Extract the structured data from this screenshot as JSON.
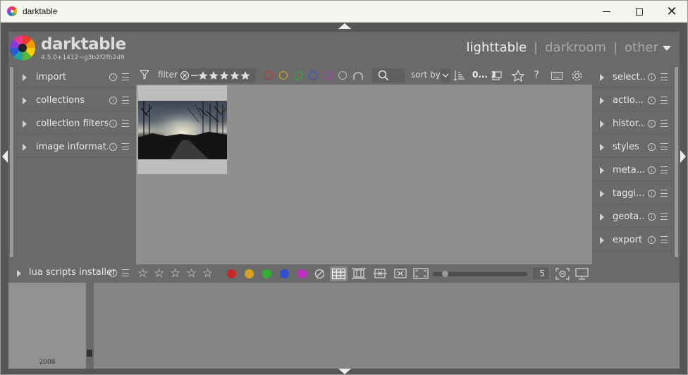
{
  "window": {
    "title": "darktable",
    "controls": {
      "minimize": "minimize",
      "maximize": "maximize",
      "close": "close"
    }
  },
  "header": {
    "brand": "darktable",
    "version": "4.5.0+1412~g3b2f2fb2d9",
    "views": [
      "lighttable",
      "darkroom",
      "other"
    ],
    "active_view": "lighttable",
    "separator": "|"
  },
  "left_panel": {
    "modules": [
      {
        "label": "import"
      },
      {
        "label": "collections"
      },
      {
        "label": "collection filters"
      },
      {
        "label": "image informat..."
      }
    ],
    "lua": {
      "label": "lua scripts installer"
    }
  },
  "toolbar": {
    "filter_label": "filter",
    "sort_label": "sort by",
    "count": "0... 1",
    "color_labels": [
      {
        "name": "red",
        "color": "#d02c2c"
      },
      {
        "name": "yellow",
        "color": "#d9a81c"
      },
      {
        "name": "green",
        "color": "#2fb12f"
      },
      {
        "name": "blue",
        "color": "#2f4fd9"
      },
      {
        "name": "purple",
        "color": "#c02fc0"
      },
      {
        "name": "gray",
        "color": "#bdbdbd"
      }
    ]
  },
  "right_panel": {
    "modules": [
      {
        "label": "select..."
      },
      {
        "label": "actio..."
      },
      {
        "label": "histor..."
      },
      {
        "label": "styles"
      },
      {
        "label": "meta..."
      },
      {
        "label": "taggi..."
      },
      {
        "label": "geota..."
      },
      {
        "label": "export"
      }
    ]
  },
  "bottombar": {
    "stars": 5,
    "color_dots": [
      "#c42a2a",
      "#d6a020",
      "#2fb12f",
      "#2f4fd9",
      "#c02fc0"
    ],
    "zoom_value": "5",
    "zoom_fraction": 0.13
  },
  "timeline": {
    "year": "2008"
  },
  "icons": {
    "star": "☆",
    "info": "i"
  }
}
